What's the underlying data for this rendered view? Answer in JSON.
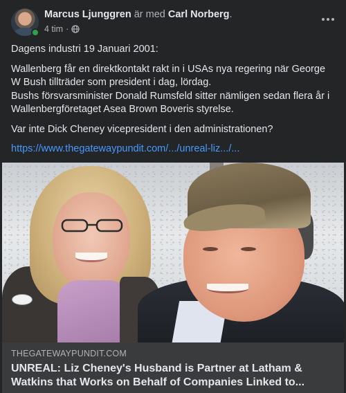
{
  "header": {
    "author": "Marcus Ljunggren",
    "with_text": "är med",
    "tagged": "Carl Norberg",
    "period": ".",
    "time": "4 tim",
    "separator": "·"
  },
  "post": {
    "line1": "Dagens industri 19 Januari 2001:",
    "para2": "Wallenberg får en direktkontakt rakt in i USAs nya regering när George W Bush tillträder som president i dag, lördag.",
    "para3": "Bushs försvarsminister Donald Rumsfeld sitter nämligen sedan flera år i Wallenbergföretaget Asea Brown Boveris styrelse.",
    "para4": "Var inte Dick Cheney vicepresident i den administrationen?",
    "link": "https://www.thegatewaypundit.com/.../unreal-liz.../..."
  },
  "preview": {
    "domain": "THEGATEWAYPUNDIT.COM",
    "title": "UNREAL: Liz Cheney's Husband is Partner at Latham & Watkins that Works on Behalf of Companies Linked to..."
  },
  "icons": {
    "avatar": "avatar",
    "online": "online-status-dot",
    "privacy": "globe-icon",
    "more": "more-options-icon"
  },
  "colors": {
    "background": "#242526",
    "link": "#4599ff",
    "online": "#31a24c",
    "preview_bg": "#3a3b3c"
  }
}
